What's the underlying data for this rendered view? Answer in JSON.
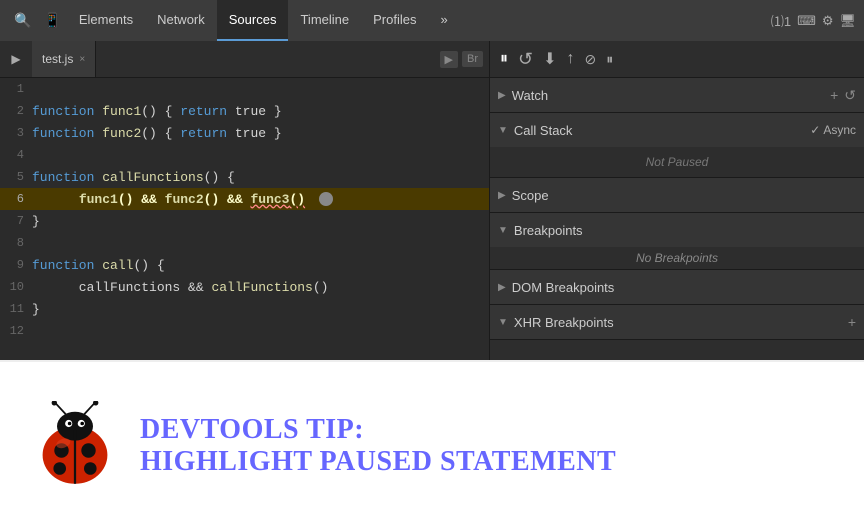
{
  "toolbar": {
    "tabs": [
      {
        "label": "Elements",
        "active": false
      },
      {
        "label": "Network",
        "active": false
      },
      {
        "label": "Sources",
        "active": true
      },
      {
        "label": "Timeline",
        "active": false
      },
      {
        "label": "Profiles",
        "active": false
      }
    ],
    "more_tabs": "»",
    "counters": "⑴1",
    "right_icons": [
      "terminal",
      "gear",
      "monitor"
    ]
  },
  "file_tab": {
    "file_name": "test.js",
    "close": "×",
    "left_icons": [
      "▶",
      "Br"
    ]
  },
  "debug_controls": {
    "pause": "⏸",
    "reload": "↺",
    "step_over": "⬇",
    "step_into": "↑",
    "deactivate": "⊘",
    "pause_exceptions": "⏸"
  },
  "code": {
    "lines": [
      {
        "num": 1,
        "text": ""
      },
      {
        "num": 2,
        "text": "function func1() { return true }"
      },
      {
        "num": 3,
        "text": "function func2() { return true }"
      },
      {
        "num": 4,
        "text": ""
      },
      {
        "num": 5,
        "text": "function callFunctions() {"
      },
      {
        "num": 6,
        "text": "     func1() && func2() && func3()",
        "highlight": true,
        "error": true
      },
      {
        "num": 7,
        "text": "}"
      },
      {
        "num": 8,
        "text": ""
      },
      {
        "num": 9,
        "text": "function call() {"
      },
      {
        "num": 10,
        "text": "     callFunctions && callFunctions()"
      },
      {
        "num": 11,
        "text": "}"
      },
      {
        "num": 12,
        "text": ""
      }
    ]
  },
  "right_panel": {
    "sections": [
      {
        "id": "watch",
        "label": "Watch",
        "collapsed": false,
        "arrow": "▶",
        "actions": [
          "+",
          "↺"
        ]
      },
      {
        "id": "call-stack",
        "label": "Call Stack",
        "collapsed": false,
        "arrow": "▼",
        "async_label": "Async",
        "async_checked": true,
        "body": "Not Paused"
      },
      {
        "id": "scope",
        "label": "Scope",
        "collapsed": true,
        "arrow": "▶"
      },
      {
        "id": "breakpoints",
        "label": "Breakpoints",
        "collapsed": false,
        "arrow": "▼",
        "body": "No Breakpoints"
      },
      {
        "id": "dom-breakpoints",
        "label": "DOM Breakpoints",
        "collapsed": true,
        "arrow": "▶"
      },
      {
        "id": "xhr-breakpoints",
        "label": "XHR Breakpoints",
        "collapsed": true,
        "arrow": "▼"
      }
    ]
  },
  "tip": {
    "prefix": "DevTools Tip:",
    "title": "Highlight Paused Statement"
  }
}
